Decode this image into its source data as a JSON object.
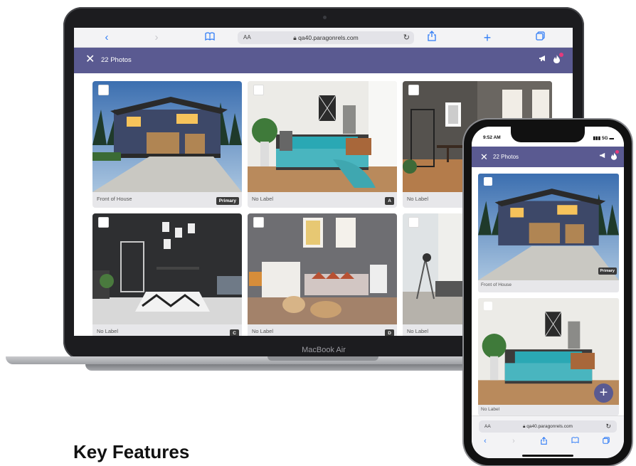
{
  "laptop": {
    "brand": "MacBook Air",
    "browser": {
      "text_size": "AA",
      "url": "qa40.paragonrels.com",
      "icons": [
        "back-icon",
        "forward-icon",
        "bookmarks-icon",
        "reload-icon",
        "share-icon",
        "new-tab-icon",
        "tabs-icon"
      ]
    },
    "app_header": {
      "close_glyph": "✕",
      "title": "22 Photos"
    },
    "photos": [
      {
        "caption": "Front of House",
        "badge": "Primary",
        "scene": "house"
      },
      {
        "caption": "No Label",
        "badge": "A",
        "scene": "bedroom"
      },
      {
        "caption": "No Label",
        "badge": "",
        "scene": "dining"
      },
      {
        "caption": "No Label",
        "badge": "C",
        "scene": "office"
      },
      {
        "caption": "No Label",
        "badge": "D",
        "scene": "living"
      },
      {
        "caption": "No Label",
        "badge": "",
        "scene": "bright"
      }
    ]
  },
  "phone": {
    "status": {
      "time": "9:52 AM",
      "signal": "5G"
    },
    "app_header": {
      "close_glyph": "✕",
      "title": "22 Photos"
    },
    "photos": [
      {
        "caption": "Front of House",
        "badge": "Primary",
        "scene": "house"
      },
      {
        "caption": "No Label",
        "badge": "",
        "scene": "bedroom"
      }
    ],
    "fab": "+",
    "browser": {
      "text_size": "AA",
      "url": "qa40.paragonrels.com"
    }
  },
  "heading": "Key Features",
  "colors": {
    "header": "#5a5a91",
    "badge_dot": "#e53a7c",
    "ios_blue": "#2f7cf6"
  }
}
